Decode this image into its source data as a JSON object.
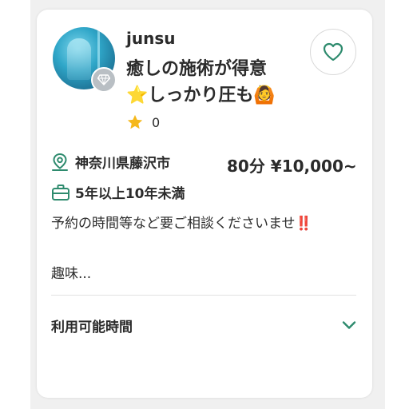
{
  "profile": {
    "username": "junsu",
    "headline": "癒しの施術が得意\n⭐しっかり圧も🙆",
    "rating_count": "0",
    "location": "神奈川県藤沢市",
    "price": "80分 ¥10,000~",
    "experience": "5年以上10年未満",
    "notice": "予約の時間等など要ご相談くださいませ‼️",
    "hobby": "趣味..."
  },
  "availability": {
    "label": "利用可能時間"
  },
  "icons": {
    "favorite": "heart-outline-icon",
    "badge": "diamond-icon",
    "rating": "star-icon",
    "location": "map-pin-icon",
    "experience": "briefcase-icon",
    "expand": "chevron-down-icon"
  },
  "colors": {
    "accent": "#2e8b6e",
    "star": "#f5b81c",
    "text": "#2b2b2b",
    "badge_bg": "#b9bfc4"
  }
}
